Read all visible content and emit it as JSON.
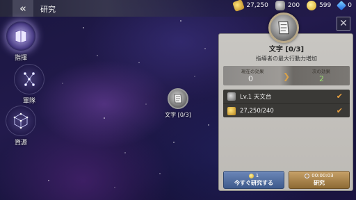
{
  "header": {
    "back_icon": "chevron-left-double-icon",
    "title": "研究"
  },
  "resources": [
    {
      "icon": "food-icon",
      "value": "27,250"
    },
    {
      "icon": "iron-icon",
      "value": "200"
    },
    {
      "icon": "gold-coin-icon",
      "value": "599"
    },
    {
      "icon": "gem-icon",
      "value": "0"
    }
  ],
  "sidebar": {
    "items": [
      {
        "label": "指揮",
        "icon": "command-book-icon",
        "active": true
      },
      {
        "label": "軍隊",
        "icon": "army-constellation-icon",
        "active": false
      },
      {
        "label": "資源",
        "icon": "resource-cube-icon",
        "active": false
      }
    ]
  },
  "node": {
    "label": "文字 [0/3]",
    "icon": "writing-scroll-icon"
  },
  "panel": {
    "title": "文字 [0/3]",
    "description": "指導者の最大行動力増加",
    "current_effect_label": "現在の効果",
    "next_effect_label": "次の効果",
    "current_effect_value": "0",
    "next_effect_value": "2",
    "requirements": [
      {
        "icon": "observatory-icon",
        "text": "Lv.1 天文台",
        "met": true
      },
      {
        "icon": "food-icon",
        "text": "27,250/240",
        "met": true
      }
    ],
    "instant_button": {
      "cost": "1",
      "label": "今すぐ研究する"
    },
    "research_button": {
      "time": "00:00:03",
      "label": "研究"
    }
  },
  "colors": {
    "accent_gold": "#c7a168",
    "instant_blue": "#6c87b8",
    "next_value_green": "#9be070",
    "check_orange": "#e8a040"
  }
}
